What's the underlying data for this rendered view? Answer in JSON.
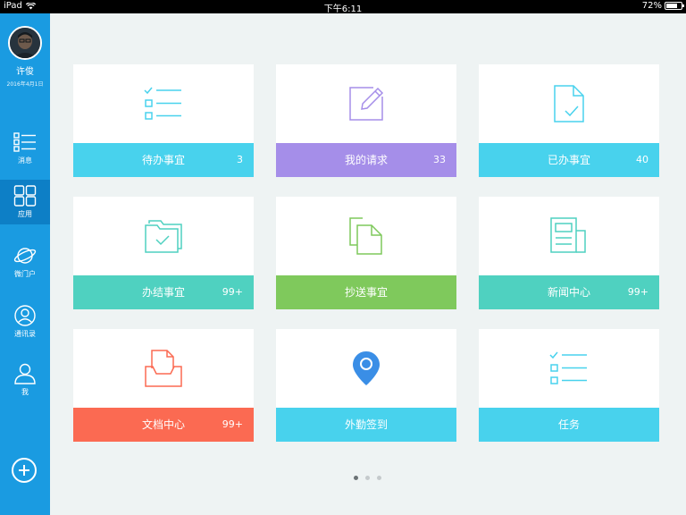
{
  "status_bar": {
    "carrier": "iPad",
    "time": "下午6:11",
    "battery": "72%",
    "battery_level": 0.72
  },
  "sidebar": {
    "user_name": "许俊",
    "user_date": "2016年4月1日",
    "items": [
      {
        "label": "消息",
        "icon": "list-icon"
      },
      {
        "label": "应用",
        "icon": "grid-icon"
      },
      {
        "label": "微门户",
        "icon": "planet-icon"
      },
      {
        "label": "通讯录",
        "icon": "contact-icon"
      },
      {
        "label": "我",
        "icon": "user-icon"
      }
    ]
  },
  "cards": [
    {
      "title": "待办事宜",
      "count": "3",
      "color": "#48d2ed",
      "icon": "checklist-icon"
    },
    {
      "title": "我的请求",
      "count": "33",
      "color": "#a58ee9",
      "icon": "edit-icon"
    },
    {
      "title": "已办事宜",
      "count": "40",
      "color": "#48d2ed",
      "icon": "document-check-icon"
    },
    {
      "title": "办结事宜",
      "count": "99+",
      "color": "#4fd1c0",
      "icon": "folder-check-icon"
    },
    {
      "title": "抄送事宜",
      "count": "",
      "color": "#7fc95c",
      "icon": "copy-icon"
    },
    {
      "title": "新闻中心",
      "count": "99+",
      "color": "#4fd1c0",
      "icon": "news-icon"
    },
    {
      "title": "文档中心",
      "count": "99+",
      "color": "#fb6a52",
      "icon": "inbox-icon"
    },
    {
      "title": "外勤签到",
      "count": "",
      "color": "#48d2ed",
      "icon": "location-pin-icon"
    },
    {
      "title": "任务",
      "count": "",
      "color": "#48d2ed",
      "icon": "task-list-icon"
    }
  ],
  "pagination": {
    "pages": 3,
    "current": 1
  }
}
